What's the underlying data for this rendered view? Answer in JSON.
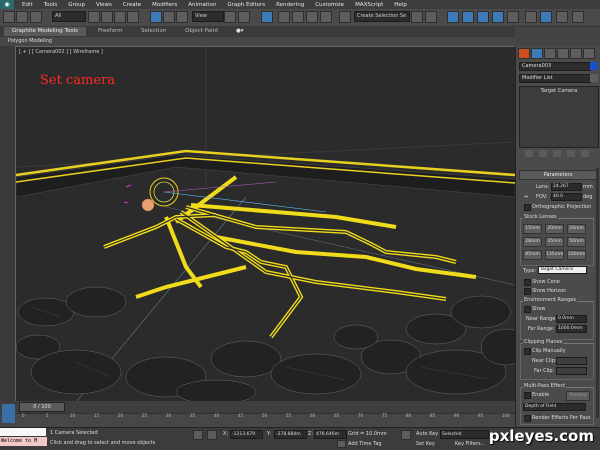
{
  "menu": [
    "Edit",
    "Tools",
    "Group",
    "Views",
    "Create",
    "Modifiers",
    "Animation",
    "Graph Editors",
    "Rendering",
    "Customize",
    "MAXScript",
    "Help"
  ],
  "toolbar": {
    "selection_filter": "All",
    "ref_coord": "View",
    "named_sel": "Create Selection Se"
  },
  "ribbon": {
    "tabs": [
      "Graphite Modeling Tools",
      "Freeform",
      "Selection",
      "Object Paint"
    ],
    "subtab": "Polygon Modeling"
  },
  "viewport": {
    "label": "[ + ] [ Camera002 ] [ Wireframe ]",
    "title": "Set camera"
  },
  "command_panel": {
    "object_name": "Camera003",
    "object_color": "#1a50c8",
    "modifier_list": "Modifier List",
    "stack_item": "Target Camera",
    "parameters_title": "Parameters",
    "lens_label": "Lens:",
    "lens_value": "24.267",
    "lens_unit": "mm",
    "fov_label": "FOV:",
    "fov_value": "40.0",
    "fov_unit": "deg",
    "ortho_label": "Orthographic Projection",
    "stock_lenses_label": "Stock Lenses",
    "stock_lenses": [
      "15mm",
      "20mm",
      "24mm",
      "28mm",
      "35mm",
      "50mm",
      "85mm",
      "135mm",
      "200mm"
    ],
    "type_label": "Type:",
    "type_value": "Target Camera",
    "show_cone": "Show Cone",
    "show_horizon": "Show Horizon",
    "env_ranges": "Environment Ranges",
    "env_show": "Show",
    "near_range_label": "Near Range:",
    "near_range_value": "0.0mm",
    "far_range_label": "Far Range:",
    "far_range_value": "1000.0mm",
    "clipping_planes": "Clipping Planes",
    "clip_manually": "Clip Manually",
    "near_clip_label": "Near Clip:",
    "far_clip_label": "Far Clip:",
    "multipass": "Multi-Pass Effect",
    "enable_label": "Enable",
    "preview_label": "Preview",
    "effect_value": "Depth of Field",
    "render_effects": "Render Effects Per Pass"
  },
  "timeline": {
    "position": "0 / 100",
    "ticks": [
      "0",
      "5",
      "10",
      "15",
      "20",
      "25",
      "30",
      "35",
      "40",
      "45",
      "50",
      "55",
      "60",
      "65",
      "70",
      "75",
      "80",
      "85",
      "90",
      "95",
      "100"
    ]
  },
  "status": {
    "maxscript": "Welcome to M",
    "selected": "1 Camera Selected",
    "prompt": "Click and drag to select and move objects",
    "x_label": "X:",
    "x_value": "-1213.679",
    "y_label": "Y:",
    "y_value": "-278.884m",
    "z_label": "Z:",
    "z_value": "476.646m",
    "grid": "Grid = 10.0mm",
    "add_time_tag": "Add Time Tag",
    "auto_key": "Auto Key",
    "set_key": "Set Key",
    "selected_dropdown": "Selected",
    "key_filters": "Key Filters..."
  },
  "watermark": "pxleyes.com"
}
